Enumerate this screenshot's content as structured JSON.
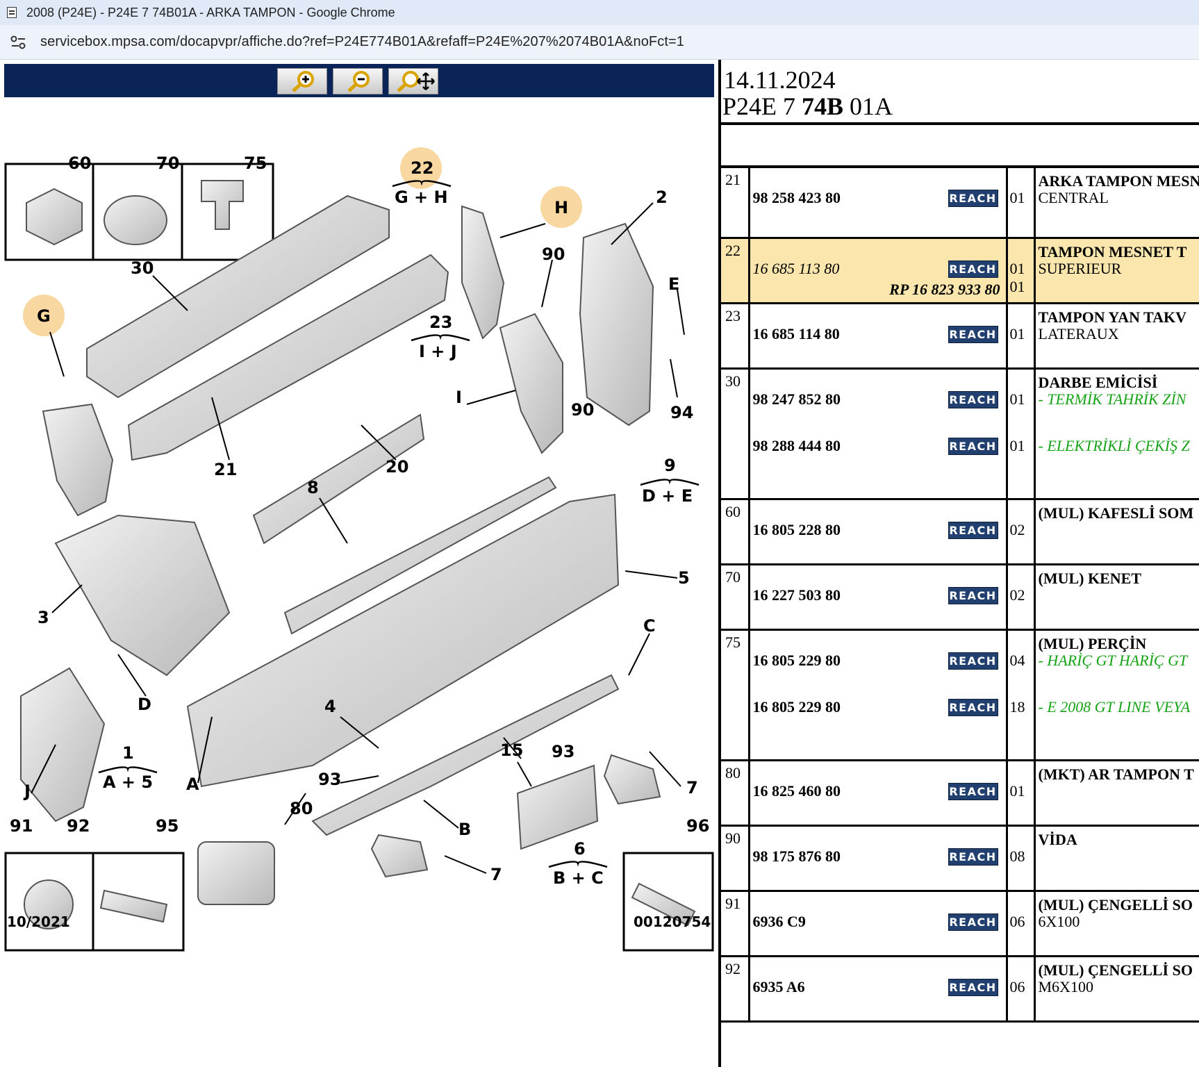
{
  "browser": {
    "window_title": "2008 (P24E) - P24E 7 74B01A - ARKA TAMPON - Google Chrome",
    "url": "servicebox.mpsa.com/docapvpr/affiche.do?ref=P24E774B01A&refaff=P24E%207%2074B01A&noFct=1"
  },
  "diagram": {
    "toolbar_buttons": [
      "zoom-in",
      "zoom-out",
      "zoom-pan"
    ],
    "callouts": [
      "60",
      "70",
      "75",
      "22",
      "G + H",
      "H",
      "2",
      "30",
      "90",
      "E",
      "G",
      "23",
      "I + J",
      "I",
      "90",
      "94",
      "21",
      "20",
      "8",
      "9",
      "D + E",
      "5",
      "3",
      "C",
      "D",
      "4",
      "15",
      "93",
      "1",
      "A + 5",
      "J",
      "A",
      "93",
      "7",
      "80",
      "B",
      "6",
      "B + C",
      "7",
      "91",
      "92",
      "95",
      "96"
    ],
    "date_code": "10/2021",
    "drawing_number": "00120754"
  },
  "parts_header": {
    "date": "14.11.2024",
    "ref_prefix": "P24E 7 ",
    "ref_bold": "74B",
    "ref_suffix": " 01A"
  },
  "reach_label": "REACH",
  "parts": [
    {
      "idx": "21",
      "refs": [
        {
          "ref": "98 258 423 80",
          "qty": "01"
        }
      ],
      "title": "ARKA TAMPON MESNET",
      "subs": [
        {
          "text": "CENTRAL",
          "green": false
        }
      ]
    },
    {
      "idx": "22",
      "highlight": true,
      "refs": [
        {
          "ref": "16 685 113 80",
          "qty": "01",
          "italic": true
        }
      ],
      "rp": "RP 16 823 933 80",
      "rp_qty": "01",
      "title": "TAMPON MESNET T",
      "subs": [
        {
          "text": "SUPERIEUR",
          "green": false
        }
      ]
    },
    {
      "idx": "23",
      "refs": [
        {
          "ref": "16 685 114 80",
          "qty": "01"
        }
      ],
      "title": "TAMPON YAN TAKV",
      "subs": [
        {
          "text": "LATERAUX",
          "green": false
        }
      ]
    },
    {
      "idx": "30",
      "refs": [
        {
          "ref": "98 247 852 80",
          "qty": "01"
        },
        {
          "ref": "98 288 444 80",
          "qty": "01"
        }
      ],
      "title": "DARBE EMİCİSİ",
      "subs": [
        {
          "text": "- TERMİK TAHRİK ZİN",
          "green": true
        },
        {
          "text": "- ELEKTRİKLİ ÇEKİŞ Z",
          "green": true
        }
      ]
    },
    {
      "idx": "60",
      "refs": [
        {
          "ref": "16 805 228 80",
          "qty": "02"
        }
      ],
      "title": "(MUL) KAFESLİ SOM",
      "subs": []
    },
    {
      "idx": "70",
      "refs": [
        {
          "ref": "16 227 503 80",
          "qty": "02"
        }
      ],
      "title": "(MUL) KENET",
      "subs": []
    },
    {
      "idx": "75",
      "refs": [
        {
          "ref": "16 805 229 80",
          "qty": "04"
        },
        {
          "ref": "16 805 229 80",
          "qty": "18"
        }
      ],
      "title": "(MUL) PERÇİN",
      "subs": [
        {
          "text": "- HARİÇ GT HARİÇ GT",
          "green": true
        },
        {
          "text": "- E 2008 GT LINE VEYA",
          "green": true
        }
      ]
    },
    {
      "idx": "80",
      "refs": [
        {
          "ref": "16 825 460 80",
          "qty": "01"
        }
      ],
      "title": "(MKT) AR TAMPON T",
      "subs": []
    },
    {
      "idx": "90",
      "refs": [
        {
          "ref": "98 175 876 80",
          "qty": "08"
        }
      ],
      "title": "VİDA",
      "subs": []
    },
    {
      "idx": "91",
      "refs": [
        {
          "ref": "6936 C9",
          "qty": "06"
        }
      ],
      "title": "(MUL) ÇENGELLİ SO",
      "subs": [
        {
          "text": "6X100",
          "green": false
        }
      ]
    },
    {
      "idx": "92",
      "refs": [
        {
          "ref": "6935 A6",
          "qty": "06"
        }
      ],
      "title": "(MUL) ÇENGELLİ SO",
      "subs": [
        {
          "text": "M6X100",
          "green": false
        }
      ]
    }
  ]
}
